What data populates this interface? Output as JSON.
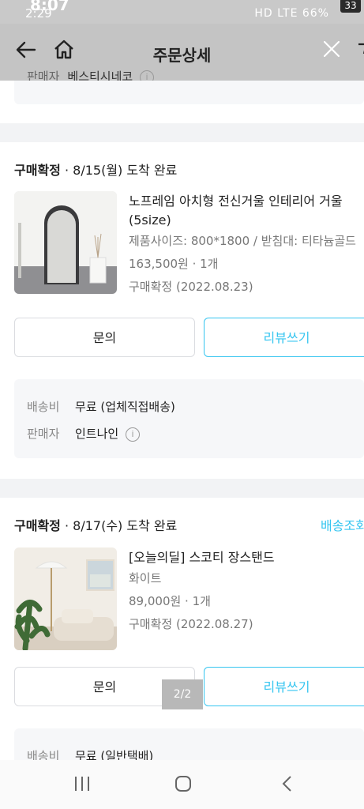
{
  "status_bar": {
    "time_back": "8:07",
    "time_front": "2:29",
    "icons_text": "HD LTE 66%",
    "battery": "33"
  },
  "header": {
    "title": "주문상세",
    "peek_label": "판매자",
    "peek_value": "베스티시네코"
  },
  "orders": [
    {
      "status": "구매확정",
      "delivery": " · 8/15(월) 도착 완료",
      "link": "",
      "name_line1": "노프레임 아치형 전신거울 인테리어 거울",
      "name_line2": "(5size)",
      "option": "제품사이즈: 800*1800 / 받침대: 티타늄골드",
      "price": "163,500원 · 1개",
      "confirm": "구매확정 (2022.08.23)",
      "btn_inquiry": "문의",
      "btn_review": "리뷰쓰기",
      "shipping_label": "배송비",
      "shipping_value": "무료 (업체직접배송)",
      "seller_label": "판매자",
      "seller_value": "인트나인"
    },
    {
      "status": "구매확정",
      "delivery": " · 8/17(수) 도착 완료",
      "link": "배송조회",
      "name_line1": "[오늘의딜] 스코티 장스탠드",
      "option": "화이트",
      "price": "89,000원 · 1개",
      "confirm": "구매확정 (2022.08.27)",
      "btn_inquiry": "문의",
      "btn_review": "리뷰쓰기",
      "shipping_label": "배송비",
      "shipping_value": "무료 (일반택배)"
    }
  ],
  "page_indicator": "2/2",
  "colors": {
    "accent": "#35c5f0",
    "header_bg": "#c4c4c4",
    "box_bg": "#f6f7f9"
  }
}
